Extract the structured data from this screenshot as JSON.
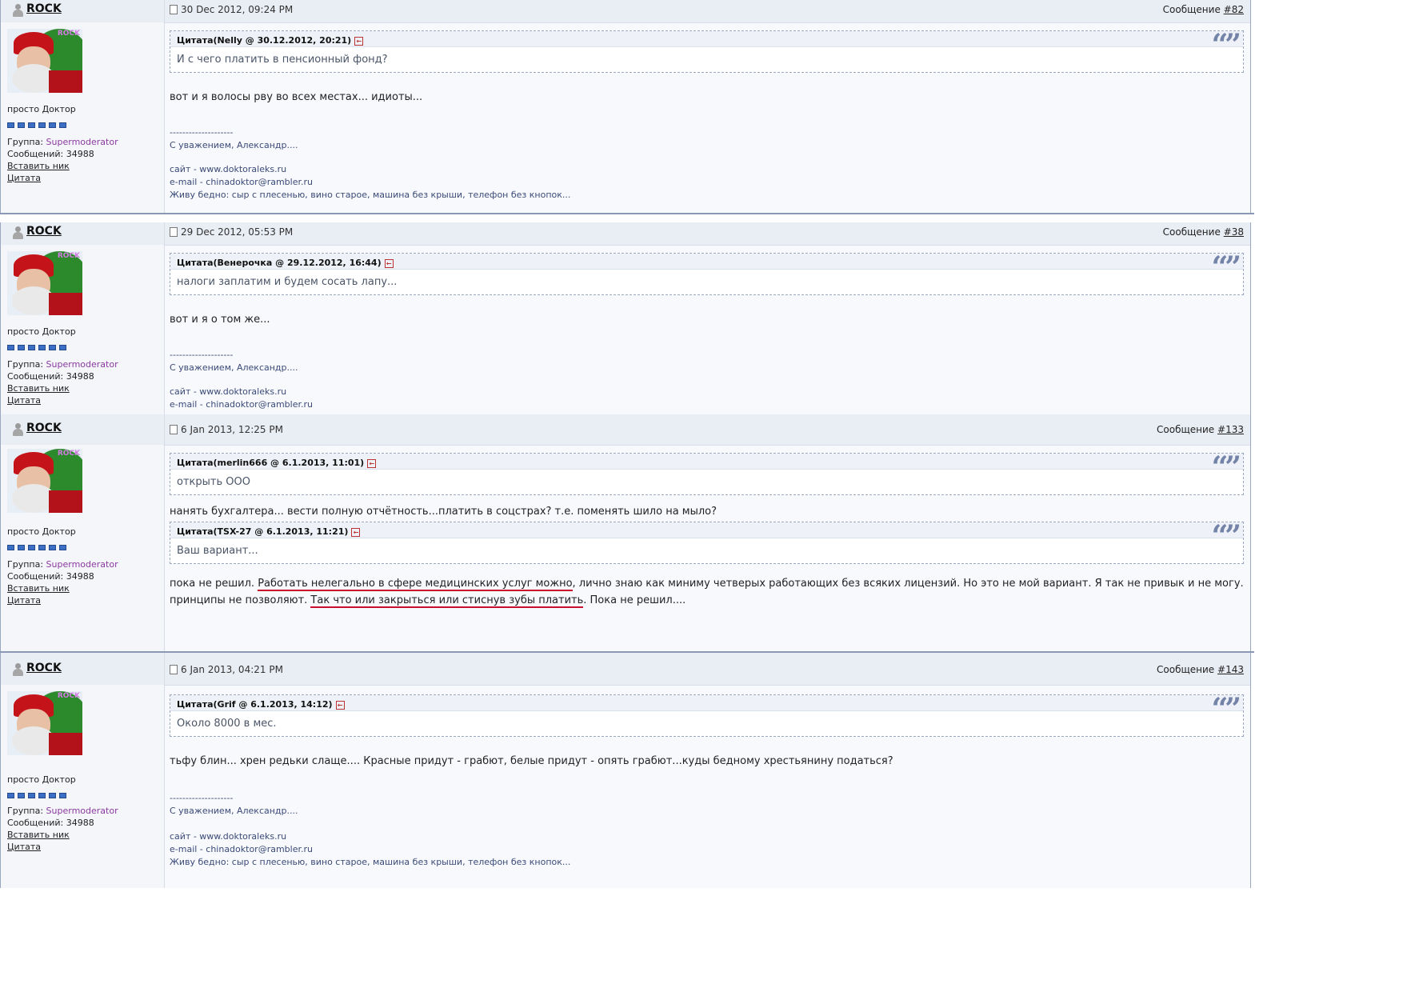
{
  "posts": [
    {
      "author": "ROCK",
      "date": "30 Dec 2012, 09:24 PM",
      "msg_label": "Сообщение",
      "msg_num": "#82",
      "user_title": "просто Доктор",
      "group_label": "Группа:",
      "group": "Supermoderator",
      "posts_label": "Сообщений:",
      "posts_count": "34988",
      "insert_nick": "Вставить ник",
      "quote_link": "Цитата",
      "quotes": [
        {
          "head": "Цитата(Nelly @ 30.12.2012, 20:21)",
          "text": "И с чего платить в пенсионный фонд?"
        }
      ],
      "text": "вот и я волосы рву во всех местах... идиоты...",
      "sig": [
        "--------------------",
        "С уважением, Александр....",
        "",
        "сайт - www.doktoraleks.ru",
        "e-mail - chinadoktor@rambler.ru",
        "Живу бедно: сыр с плесенью, вино старое, машина без крыши, телефон без кнопок..."
      ]
    },
    {
      "author": "ROCK",
      "date": "29 Dec 2012, 05:53 PM",
      "msg_label": "Сообщение",
      "msg_num": "#38",
      "user_title": "просто Доктор",
      "group_label": "Группа:",
      "group": "Supermoderator",
      "posts_label": "Сообщений:",
      "posts_count": "34988",
      "insert_nick": "Вставить ник",
      "quote_link": "Цитата",
      "quotes": [
        {
          "head": "Цитата(Венерочка @ 29.12.2012, 16:44)",
          "text": "налоги заплатим и будем сосать лапу..."
        }
      ],
      "text": "вот и я о том же...",
      "sig": [
        "--------------------",
        "С уважением, Александр....",
        "",
        "сайт - www.doktoraleks.ru",
        "e-mail - chinadoktor@rambler.ru"
      ]
    },
    {
      "author": "ROCK",
      "date": "6 Jan 2013, 12:25 PM",
      "msg_label": "Сообщение",
      "msg_num": "#133",
      "user_title": "просто Доктор",
      "group_label": "Группа:",
      "group": "Supermoderator",
      "posts_label": "Сообщений:",
      "posts_count": "34988",
      "insert_nick": "Вставить ник",
      "quote_link": "Цитата",
      "quote1": {
        "head": "Цитата(merlin666 @ 6.1.2013, 11:01)",
        "text": "открыть ООО"
      },
      "text1": "нанять бухгалтера... вести полную отчётность...платить в соцстрах? т.е. поменять шило на мыло?",
      "quote2": {
        "head": "Цитата(TSX-27 @ 6.1.2013, 11:21)",
        "text": "Ваш вариант..."
      },
      "text2_a": "пока не решил. ",
      "text2_u1": "Работать нелегально в сфере медицинских услуг можно",
      "text2_b": ", лично знаю как миниму четверых работающих без всяких лицензий. Но это не мой вариант. Я так не привык и не могу. принципы не позволяют. ",
      "text2_u2": "Так что или закрыться или стиснув зубы платить",
      "text2_c": ". Пока не решил...."
    },
    {
      "author": "ROCK",
      "date": "6 Jan 2013, 04:21 PM",
      "msg_label": "Сообщение",
      "msg_num": "#143",
      "user_title": "просто Доктор",
      "group_label": "Группа:",
      "group": "Supermoderator",
      "posts_label": "Сообщений:",
      "posts_count": "34988",
      "insert_nick": "Вставить ник",
      "quote_link": "Цитата",
      "quotes": [
        {
          "head": "Цитата(Grif @ 6.1.2013, 14:12)",
          "text": "Около 8000 в мес."
        }
      ],
      "text": "тьфу блин... хрен редьки слаще.... Красные придут - грабют, белые придут - опять грабют...куды бедному хрестьянину податься?",
      "sig": [
        "--------------------",
        "С уважением, Александр....",
        "",
        "сайт - www.doktoraleks.ru",
        "e-mail - chinadoktor@rambler.ru",
        "Живу бедно: сыр с плесенью, вино старое, машина без крыши, телефон без кнопок..."
      ]
    }
  ],
  "colors": {
    "accent": "#3b4a78",
    "group": "#8a3aa0",
    "underline": "#c8102e"
  }
}
